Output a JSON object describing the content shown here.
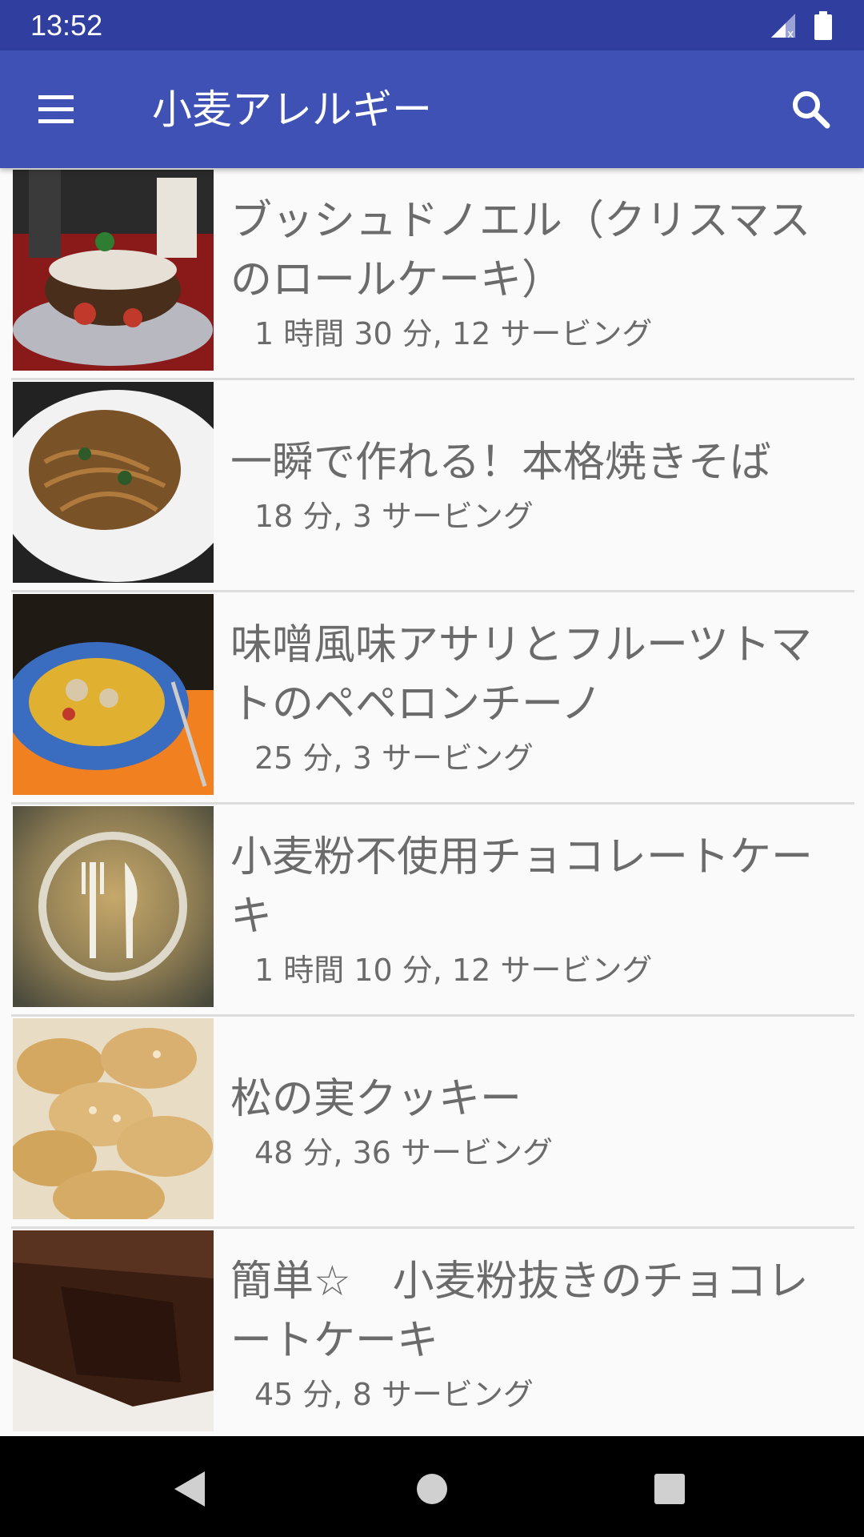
{
  "status": {
    "time": "13:52",
    "icons": [
      "signal-icon",
      "battery-icon"
    ]
  },
  "app_bar": {
    "title": "小麦アレルギー",
    "menu_icon": "menu-icon",
    "search_icon": "search-icon"
  },
  "recipes": [
    {
      "title": "ブッシュドノエル（クリスマスのロールケーキ）",
      "meta": "1 時間 30 分, 12 サービング",
      "image": "yule-log-cake-photo"
    },
    {
      "title": "一瞬で作れる！本格焼きそば",
      "meta": "18 分, 3 サービング",
      "image": "yakisoba-photo"
    },
    {
      "title": "味噌風味アサリとフルーツトマトのペペロンチーノ",
      "meta": "25 分, 3 サービング",
      "image": "clam-pasta-photo"
    },
    {
      "title": "小麦粉不使用チョコレートケーキ",
      "meta": "1 時間 10 分, 12 サービング",
      "image": "placeholder-fork-knife-icon"
    },
    {
      "title": "松の実クッキー",
      "meta": "48 分, 36 サービング",
      "image": "pine-nut-cookies-photo"
    },
    {
      "title": "簡単☆　小麦粉抜きのチョコレートケーキ",
      "meta": "45 分, 8 サービング",
      "image": "chocolate-cake-photo"
    }
  ],
  "nav_bar": {
    "back": "back-icon",
    "home": "home-icon",
    "recents": "recents-icon"
  },
  "colors": {
    "status_bar": "#303f9f",
    "app_bar": "#3f51b5",
    "text": "#6b6b6b",
    "divider": "#dcdcdc"
  }
}
